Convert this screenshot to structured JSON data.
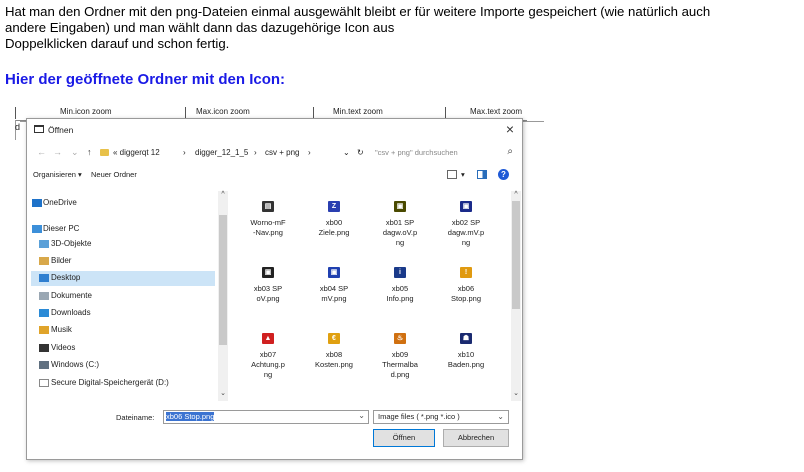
{
  "doc": {
    "paragraph_lines": [
      "Hat man den Ordner mit den png-Dateien einmal ausgewählt bleibt er für weitere Importe gespeichert (wie natürlich auch",
      "andere Eingaben) und man wählt dann das dazugehörige Icon aus",
      "Doppelklicken darauf und schon fertig."
    ],
    "heading": "Hier der geöffnete Ordner mit den Icon:"
  },
  "zoom_bar": {
    "labels": [
      "Min.icon zoom",
      "Max.icon zoom",
      "Min.text zoom",
      "Max.text zoom"
    ],
    "fragment": "d"
  },
  "dialog": {
    "title": "Öffnen",
    "close": "×",
    "address": {
      "back": "←",
      "forward": "→",
      "history": "⌄",
      "up": "↑",
      "crumbs": [
        "«  diggerqt 12",
        "›",
        "digger_12_1_5",
        "›",
        "csv + png",
        "›"
      ],
      "dropdown": "⌄",
      "refresh": "↻",
      "search_placeholder": "\"csv + png\" durchsuchen",
      "search_icon": "⌕"
    },
    "toolbar": {
      "organize": "Organisieren  ▾",
      "new_folder": "Neuer Ordner",
      "view_arrow": "▾",
      "help": "?"
    },
    "nav_items": [
      {
        "label": "OneDrive",
        "sub": false,
        "selected": false,
        "icon_color": "#1e72c9"
      },
      {
        "label": "Dieser PC",
        "sub": false,
        "selected": false,
        "icon_color": "#3c8fd9"
      },
      {
        "label": "3D-Objekte",
        "sub": true,
        "selected": false,
        "icon_color": "#5aa0d8"
      },
      {
        "label": "Bilder",
        "sub": true,
        "selected": false,
        "icon_color": "#d8a84a"
      },
      {
        "label": "Desktop",
        "sub": true,
        "selected": true,
        "icon_color": "#2f7fd0"
      },
      {
        "label": "Dokumente",
        "sub": true,
        "selected": false,
        "icon_color": "#9aa7b3"
      },
      {
        "label": "Downloads",
        "sub": true,
        "selected": false,
        "icon_color": "#2a8ad6"
      },
      {
        "label": "Musik",
        "sub": true,
        "selected": false,
        "icon_color": "#e0a42a"
      },
      {
        "label": "Videos",
        "sub": true,
        "selected": false,
        "icon_color": "#333333"
      },
      {
        "label": "Windows (C:)",
        "sub": true,
        "selected": false,
        "icon_color": "#607080"
      },
      {
        "label": "Secure Digital-Speichergerät (D:)",
        "sub": true,
        "selected": false,
        "icon_color": "#ffffff"
      }
    ],
    "scroll": {
      "up": "^",
      "down": "⌄"
    },
    "files": [
      {
        "label": "Worno-mF\n-Nav.png",
        "icon_color": "#333333",
        "glyph": "▤"
      },
      {
        "label": "xb00\nZiele.png",
        "icon_color": "#2a3fb0",
        "glyph": "Z"
      },
      {
        "label": "xb01 SP\ndagw.oV.p\nng",
        "icon_color": "#4a4a00",
        "glyph": "▣"
      },
      {
        "label": "xb02 SP\ndagw.mV.p\nng",
        "icon_color": "#1a2a8a",
        "glyph": "▣"
      },
      {
        "label": "xb03 SP\noV.png",
        "icon_color": "#222222",
        "glyph": "▣"
      },
      {
        "label": "xb04 SP\nmV.png",
        "icon_color": "#2040b0",
        "glyph": "▣"
      },
      {
        "label": "xb05\nInfo.png",
        "icon_color": "#1a3a8a",
        "glyph": "i"
      },
      {
        "label": "xb06\nStop.png",
        "icon_color": "#e09a10",
        "glyph": "!"
      },
      {
        "label": "xb07\nAchtung.p\nng",
        "icon_color": "#d02020",
        "glyph": "▲"
      },
      {
        "label": "xb08\nKosten.png",
        "icon_color": "#e0a010",
        "glyph": "€"
      },
      {
        "label": "xb09\nThermalba\nd.png",
        "icon_color": "#d07010",
        "glyph": "♨"
      },
      {
        "label": "xb10\nBaden.png",
        "icon_color": "#1a2a70",
        "glyph": "☗"
      }
    ],
    "bottom": {
      "filename_label": "Dateiname:",
      "filename_value": "xb06 Stop.png",
      "filename_dropdown": "⌄",
      "filetype_value": "Image files ( *.png *.ico )",
      "filetype_dropdown": "⌄",
      "open_button": "Öffnen",
      "cancel_button": "Abbrechen"
    }
  },
  "colors": {
    "heading": "#1a1ae6",
    "selection": "#cce4f7",
    "accent": "#0078d7"
  }
}
